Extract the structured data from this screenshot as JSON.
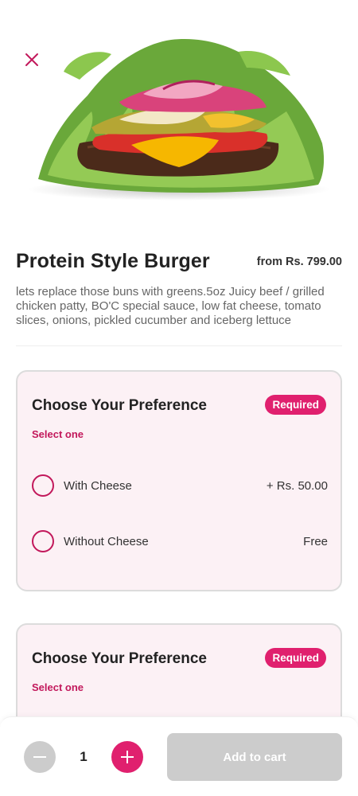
{
  "colors": {
    "accent": "#e0206e",
    "accent_text": "#c2185b",
    "card_bg": "#fcf1f5",
    "disabled": "#cccccc"
  },
  "header": {
    "close_icon": "close-icon"
  },
  "product": {
    "image_icon": "burger-image",
    "name": "Protein Style Burger",
    "price": "from Rs. 799.00",
    "description": "lets replace those buns with greens.5oz Juicy beef / grilled chicken patty, BO'C special sauce, low fat cheese, tomato slices, onions, pickled cucumber and iceberg lettuce"
  },
  "preferences": [
    {
      "title": "Choose Your Preference",
      "badge": "Required",
      "subtitle": "Select one",
      "options": [
        {
          "label": "With Cheese",
          "price": "+ Rs. 50.00"
        },
        {
          "label": "Without Cheese",
          "price": "Free"
        }
      ]
    },
    {
      "title": "Choose Your Preference",
      "badge": "Required",
      "subtitle": "Select one"
    }
  ],
  "cart": {
    "quantity": "1",
    "add_label": "Add to cart"
  }
}
